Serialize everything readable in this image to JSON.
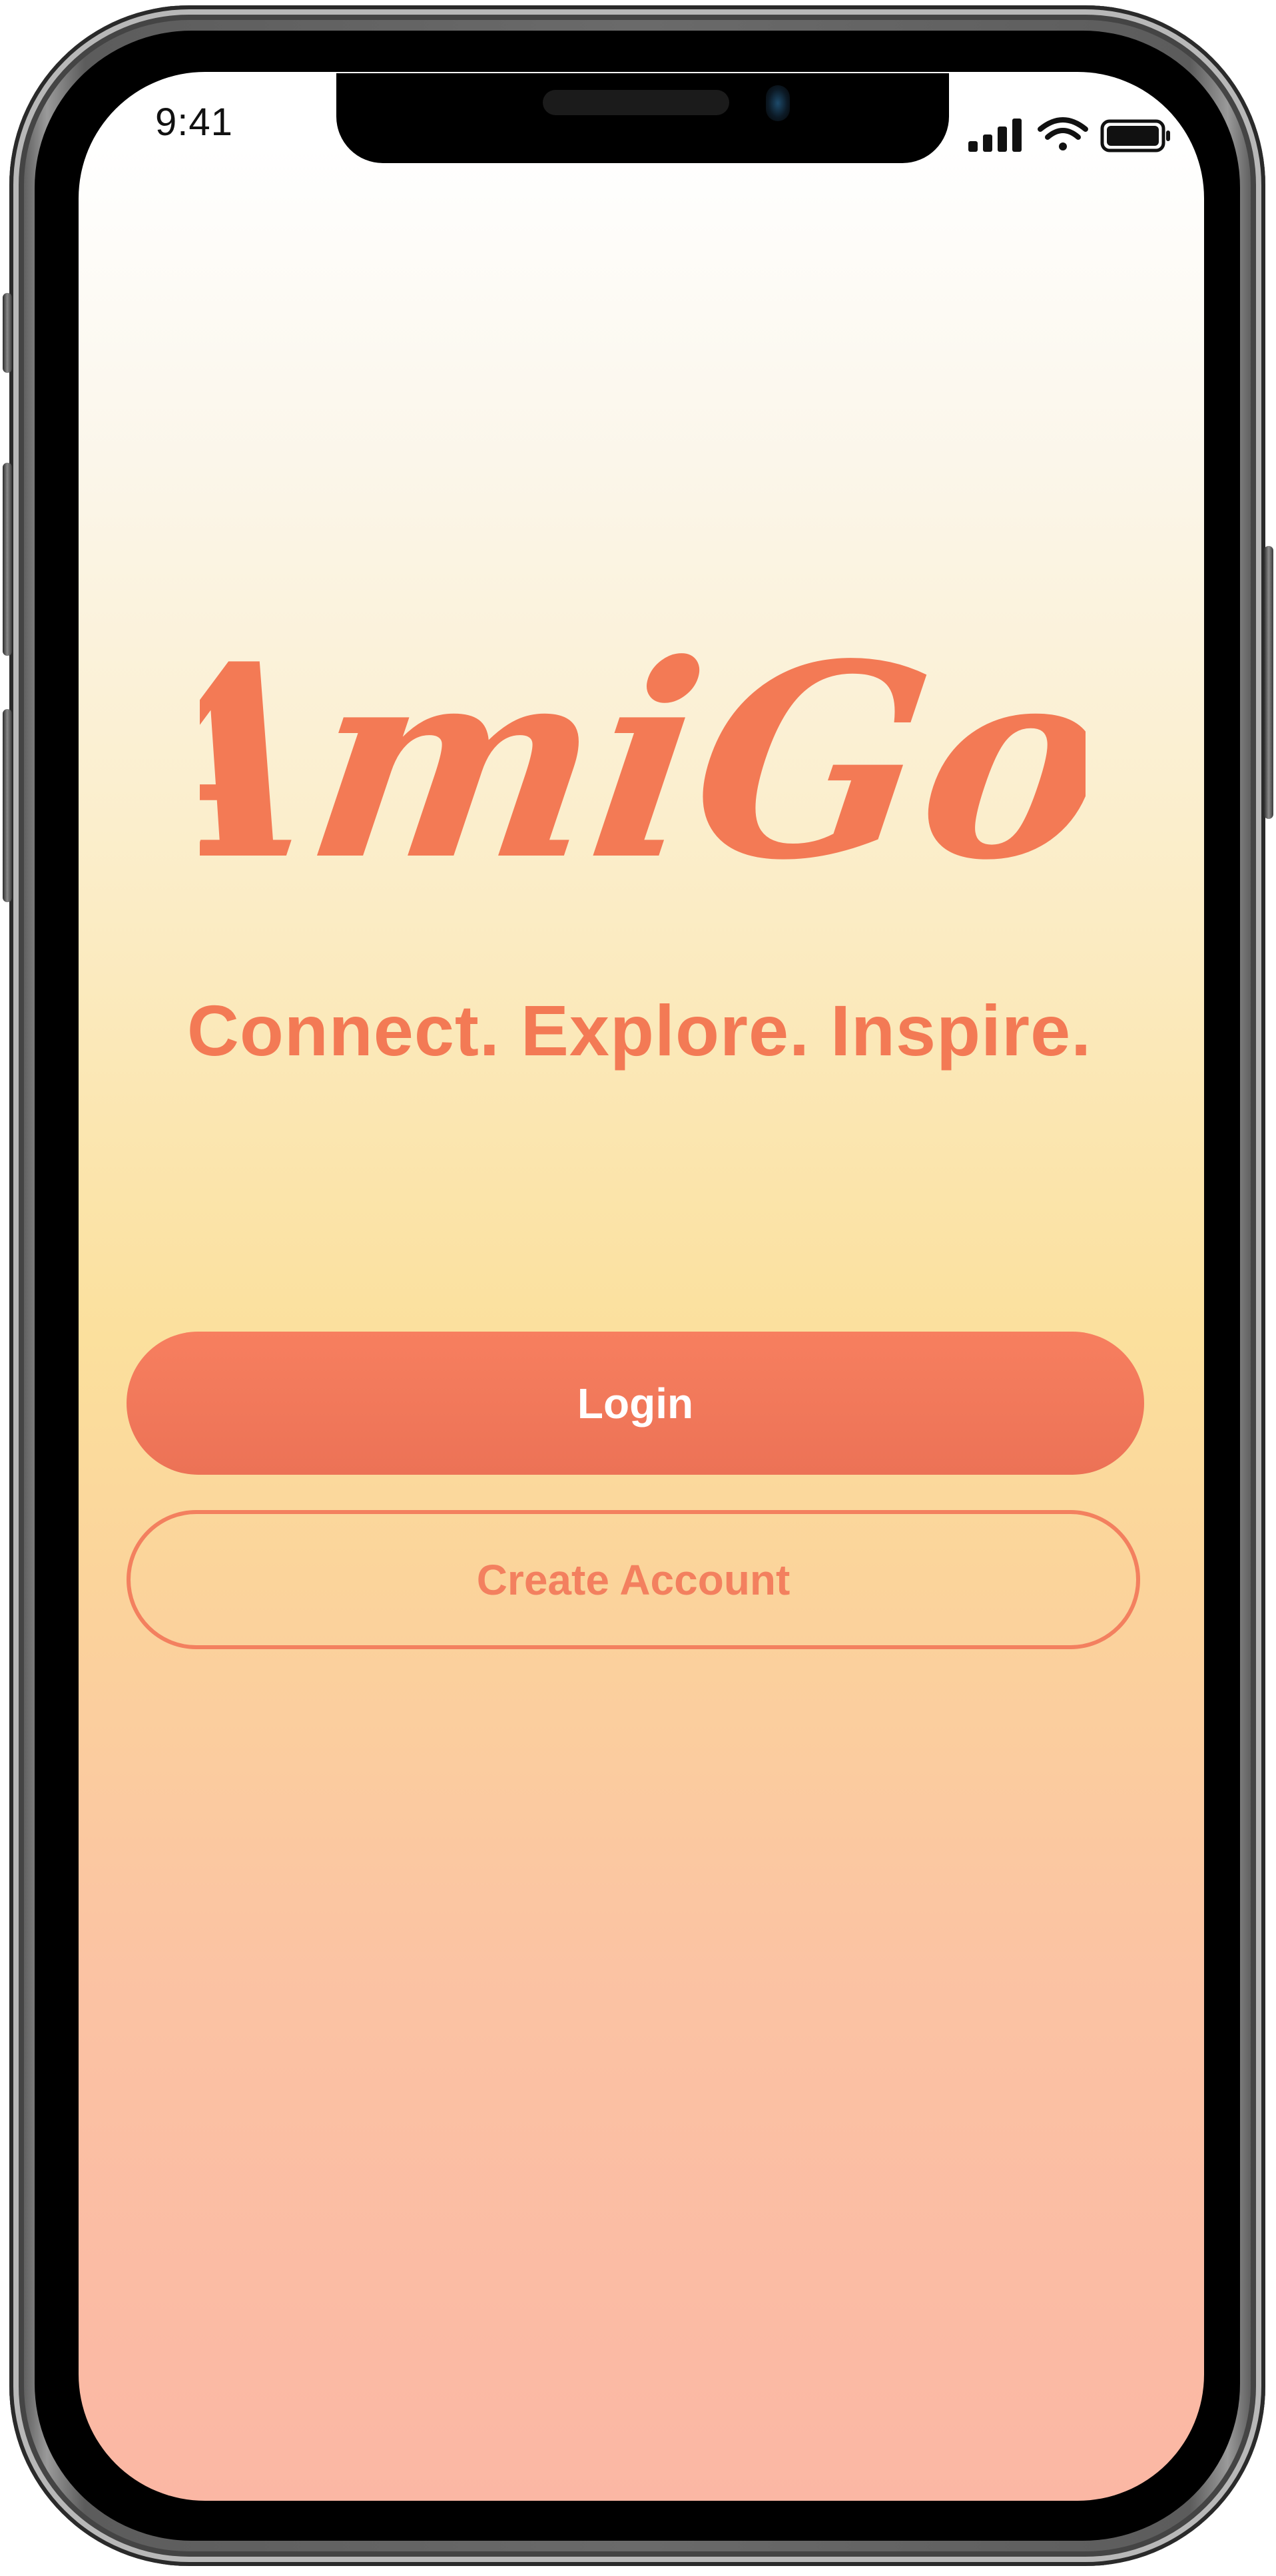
{
  "status_bar": {
    "time": "9:41",
    "icons": [
      "cellular-signal-icon",
      "wifi-icon",
      "battery-icon"
    ]
  },
  "app": {
    "logo_text": "AmiGo",
    "tagline": "Connect. Explore. Inspire."
  },
  "actions": {
    "login_label": "Login",
    "create_account_label": "Create Account"
  },
  "colors": {
    "brand": "#F37A55",
    "button_fill": "#F47B5B",
    "button_text": "#FFFFFF"
  }
}
